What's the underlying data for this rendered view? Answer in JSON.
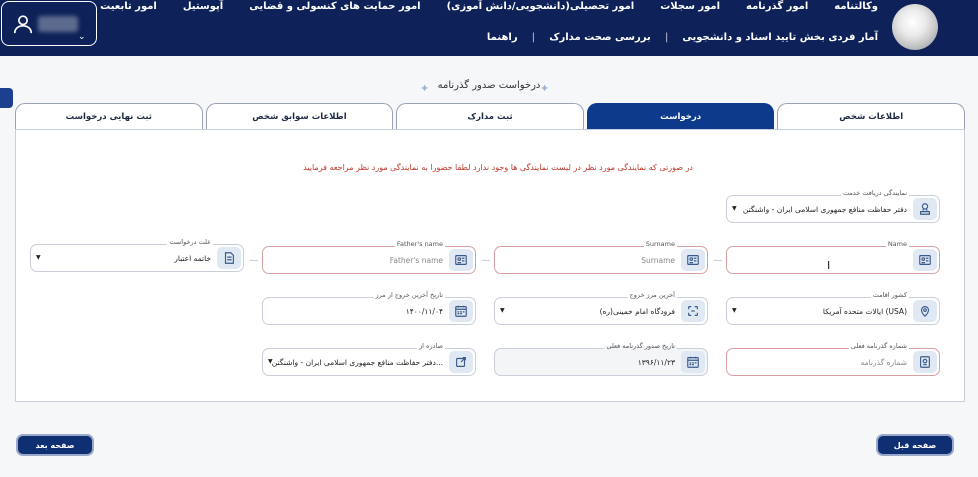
{
  "header": {
    "nav_row1": [
      "وکالتنامه",
      "امور گذرنامه",
      "امور سجلات",
      "امور تحصیلی(دانشجویی/دانش آموزی)",
      "امور حمایت های کنسولی و قضایی",
      "آپوستیل",
      "امور تابعیت"
    ],
    "nav_row2": [
      "آمار فردی بخش تایید اسناد و دانشجویی",
      "بررسی صحت مدارک",
      "راهنما"
    ],
    "logo_icon": "emblem-flower-logo",
    "user_icon": "user-icon",
    "user_menu_icon": "chevron-down-icon"
  },
  "page": {
    "title": "درخواست صدور گذرنامه"
  },
  "tabs": [
    {
      "label": "اطلاعات شخص",
      "active": false
    },
    {
      "label": "درخواست",
      "active": true
    },
    {
      "label": "ثبت مدارک",
      "active": false
    },
    {
      "label": "اطلاعات سوابق شخص",
      "active": false
    },
    {
      "label": "ثبت نهایی درخواست",
      "active": false
    }
  ],
  "notice": "در صورتی که نمایندگی مورد نظر در لیست نمایندگی ها وجود ندارد لطفا حضورا به نمایندگی مورد نظر مراجعه فرمایید",
  "form": {
    "service_office": {
      "label": "نمایندگی دریافت خدمت",
      "value": "دفتر حفاظت منافع جمهوری اسلامی ایران - واشنگتن"
    },
    "name": {
      "label": "Name",
      "placeholder": ""
    },
    "surname": {
      "label": "Surname",
      "placeholder": "Surname"
    },
    "fathers_name": {
      "label": "Father's name",
      "placeholder": "Father's name"
    },
    "request_reason": {
      "label": "علت درخواست",
      "value": "خاتمه اعتبار"
    },
    "residence_country": {
      "label": "کشور اقامت",
      "value": "ایالات متحده آمریکا (USA)"
    },
    "last_exit_border": {
      "label": "آخرین مرز خروج",
      "value": "فرودگاه امام خمینی(ره)"
    },
    "last_exit_date": {
      "label": "تاریخ آخرین خروج از مرز",
      "value": "۱۴۰۰/۱۱/۰۴"
    },
    "current_passport_number": {
      "label": "شماره گذرنامه فعلی",
      "placeholder": "شماره گذرنامه"
    },
    "current_passport_issue_date": {
      "label": "تاریخ صدور گذرنامه فعلی",
      "value": "۱۳۹۶/۱۱/۲۳"
    },
    "issued_by": {
      "label": "صادره از",
      "value": "دفتر حفاظت منافع جمهوری اسلامی ایران - واشنگتن..."
    }
  },
  "buttons": {
    "previous_page": "صفحه قبل",
    "next_page": "صفحه بعد"
  },
  "colors": {
    "header_bg": "#0e2158",
    "active_tab": "#0e3a8c",
    "button_bg": "#0e2f72",
    "notice": "#c0392b"
  }
}
